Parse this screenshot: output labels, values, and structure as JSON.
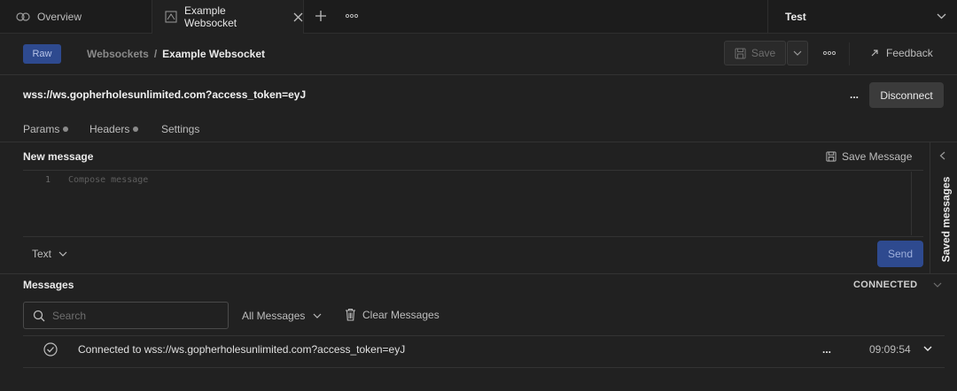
{
  "tabs": [
    {
      "label": "Overview",
      "icon": "overview-icon"
    },
    {
      "label": "Example Websocket",
      "icon": "websocket-icon",
      "active": true
    }
  ],
  "environment": {
    "label": "Test"
  },
  "header": {
    "badge": "Raw",
    "breadcrumb_parent": "Websockets",
    "breadcrumb_separator": "/",
    "breadcrumb_current": "Example Websocket",
    "save_label": "Save",
    "feedback_label": "Feedback"
  },
  "connection": {
    "url": "wss://ws.gopherholesunlimited.com?access_token=eyJ",
    "more_label": "...",
    "disconnect_label": "Disconnect"
  },
  "request_tabs": {
    "params": "Params",
    "headers": "Headers",
    "settings": "Settings"
  },
  "composer": {
    "title": "New message",
    "save_message_label": "Save Message",
    "line_number": "1",
    "placeholder": "Compose message",
    "format_label": "Text",
    "send_label": "Send",
    "saved_messages_label": "Saved messages"
  },
  "messages": {
    "title": "Messages",
    "status": "CONNECTED",
    "search_placeholder": "Search",
    "filter_label": "All Messages",
    "clear_label": "Clear Messages",
    "items": [
      {
        "text": "Connected to wss://ws.gopherholesunlimited.com?access_token=eyJ",
        "more": "...",
        "time": "09:09:54"
      }
    ]
  },
  "colors": {
    "accent": "#2e4a8f",
    "background": "#212121",
    "tabbar": "#1c1c1c"
  }
}
